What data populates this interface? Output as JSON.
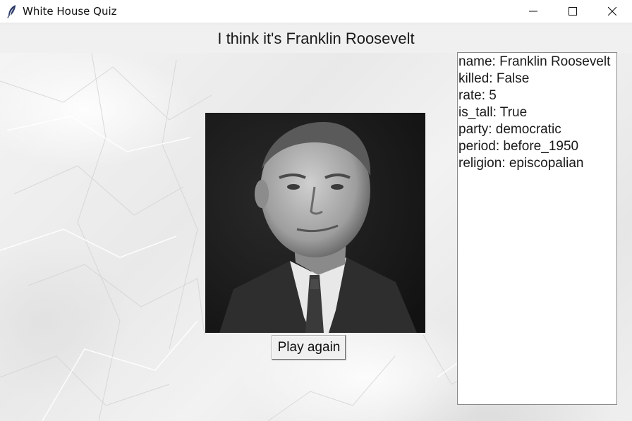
{
  "window": {
    "title": "White House Quiz",
    "icon": "feather-icon",
    "controls": [
      "minimize-icon",
      "maximize-icon",
      "close-icon"
    ]
  },
  "heading": "I think it's Franklin Roosevelt",
  "portrait": {
    "subject": "Franklin Roosevelt"
  },
  "play_again_label": "Play again",
  "info": [
    "name: Franklin Roosevelt",
    "killed: False",
    "rate: 5",
    "is_tall: True",
    "party: democratic",
    "period: before_1950",
    "religion: episcopalian"
  ],
  "colors": {
    "titlebar": "#ffffff",
    "heading_bar": "#f0f0f0",
    "panel": "#ffffff"
  }
}
